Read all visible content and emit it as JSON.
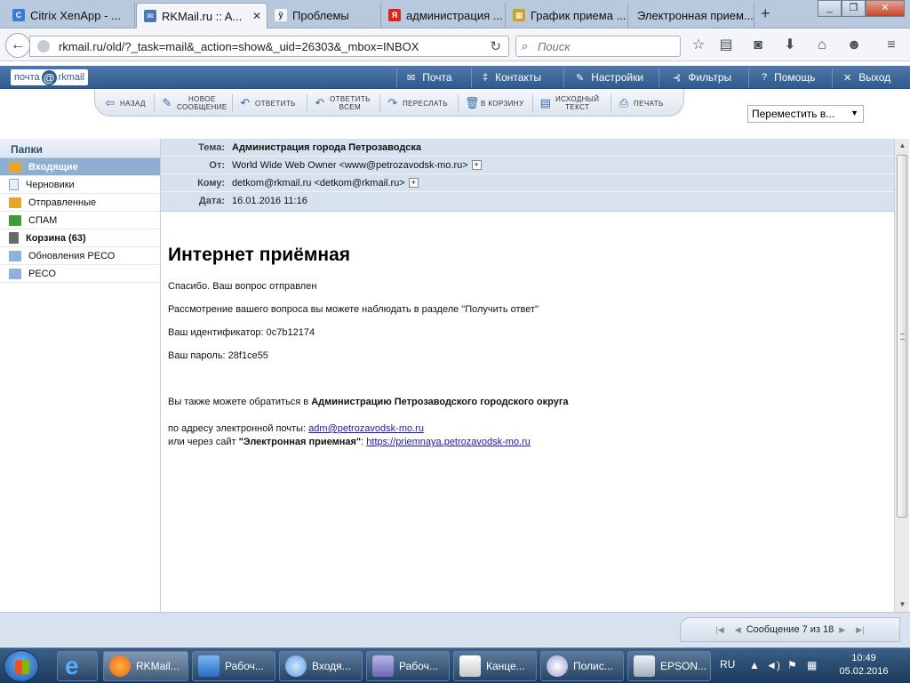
{
  "browser": {
    "tabs": [
      {
        "title": "Citrix XenApp - ...",
        "icon_color": "#3a7bd5",
        "icon_letter": "C"
      },
      {
        "title": "RKMail.ru :: A...",
        "icon_color": "#4a78b0",
        "icon_letter": "✉"
      },
      {
        "title": "Проблемы",
        "icon_color": "#333333",
        "icon_letter": "ў"
      },
      {
        "title": "администрация ...",
        "icon_color": "#d8261b",
        "icon_letter": "Я"
      },
      {
        "title": "График приема ...",
        "icon_color": "#c9a227",
        "icon_letter": "▦"
      },
      {
        "title": "Электронная прием...",
        "icon_color": "#ffffff",
        "icon_letter": ""
      }
    ],
    "new_tab": "+",
    "url": "rkmail.ru/old/?_task=mail&_action=show&_uid=26303&_mbox=INBOX",
    "search_placeholder": "Поиск"
  },
  "mail": {
    "logo_left": "почта",
    "logo_at": "@",
    "logo_right": "rkmail",
    "topnav": [
      {
        "icon": "✉",
        "label": "Почта"
      },
      {
        "icon": "‡",
        "label": "Контакты"
      },
      {
        "icon": "✎",
        "label": "Настройки"
      },
      {
        "icon": "⊰",
        "label": "Фильтры"
      },
      {
        "icon": "?",
        "label": "Помощь"
      },
      {
        "icon": "✕",
        "label": "Выход"
      }
    ],
    "toolbar": {
      "back": "назад",
      "new_line1": "новое",
      "new_line2": "сообщение",
      "reply": "ответить",
      "reply_all_line1": "ответить",
      "reply_all_line2": "всем",
      "forward": "переслать",
      "trash": "в корзину",
      "source_line1": "исходный",
      "source_line2": "текст",
      "print": "печать"
    },
    "move_to": "Переместить в...",
    "folders_title": "Папки",
    "folders": [
      {
        "label": "Входящие",
        "icon_color": "#e3a62b"
      },
      {
        "label": "Черновики",
        "icon_color": "#e8eef6"
      },
      {
        "label": "Отправленные",
        "icon_color": "#e3a62b"
      },
      {
        "label": "СПАМ",
        "icon_color": "#3e9a3a"
      },
      {
        "label": "Корзина (63)",
        "icon_color": "#6a6a6a"
      },
      {
        "label": "Обновления РЕСО",
        "icon_color": "#8fb1dd"
      },
      {
        "label": "РЕСО",
        "icon_color": "#8fb1dd"
      }
    ],
    "header": {
      "subject_label": "Тема:",
      "subject": "Администрация города Петрозаводска",
      "from_label": "От:",
      "from": "World Wide Web Owner <www@petrozavodsk-mo.ru>",
      "to_label": "Кому:",
      "to": "detkom@rkmail.ru <detkom@rkmail.ru>",
      "date_label": "Дата:",
      "date": "16.01.2016 11:16"
    },
    "body": {
      "title": "Интернет приёмная",
      "line1": "Спасибо. Ваш вопрос отправлен",
      "line2": "Рассмотрение вашего вопроса вы можете наблюдать в разделе \"Получить ответ\"",
      "line3": "Ваш идентификатор: 0c7b12174",
      "line4": "Ваш пароль: 28f1ce55",
      "line5_prefix": "Вы также можете обратиться в ",
      "line5_bold": "Администрацию Петрозаводского городского округа",
      "line6_prefix": "по адресу электронной почты: ",
      "line6_link": "adm@petrozavodsk-mo.ru",
      "line7_prefix": "или через сайт ",
      "line7_bold": "\"Электронная приемная\"",
      "line7_colon": ": ",
      "line7_link": "https://priemnaya.petrozavodsk-mo.ru"
    },
    "pager": "Сообщение 7 из 18"
  },
  "taskbar": {
    "tasks": [
      {
        "label": "RKMail...",
        "icon_color": "#e8641c"
      },
      {
        "label": "Рабоч...",
        "icon_color": "#4a90d9"
      },
      {
        "label": "Входя...",
        "icon_color": "#5aa0e0"
      },
      {
        "label": "Рабоч...",
        "icon_color": "#8a8ad0"
      },
      {
        "label": "Канце...",
        "icon_color": "#e6e6e6"
      },
      {
        "label": "Полис...",
        "icon_color": "#d0d0f0"
      },
      {
        "label": "EPSON...",
        "icon_color": "#cfd8e2"
      }
    ],
    "lang": "RU",
    "time": "10:49",
    "date": "05.02.2016"
  }
}
